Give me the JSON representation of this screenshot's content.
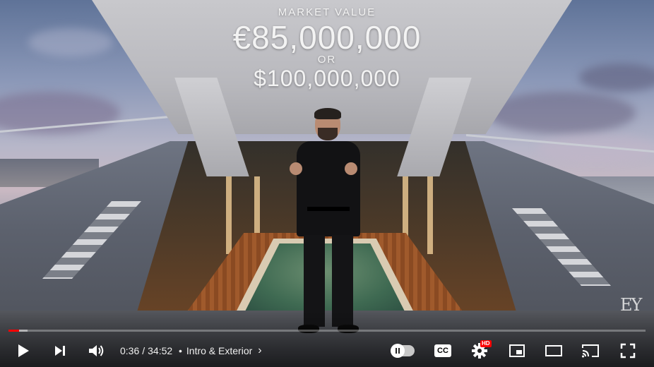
{
  "overlay": {
    "label": "MARKET VALUE",
    "eur": "€85,000,000",
    "or": "OR",
    "usd": "$100,000,000"
  },
  "brand": {
    "watermark": "EY"
  },
  "player": {
    "current_time": "0:36",
    "separator": "/",
    "duration": "34:52",
    "chapter_bullet": "•",
    "chapter": "Intro & Exterior",
    "progress_played_fraction": 0.017,
    "progress_loaded_fraction": 0.03,
    "hd_badge": "HD",
    "cc_label": "CC",
    "colors": {
      "progress_played": "#ff0000",
      "hd_badge": "#ff0000"
    }
  },
  "icons": {
    "play": "play-icon",
    "next": "next-icon",
    "volume": "volume-icon",
    "chapter_chevron": "chevron-right-icon",
    "autoplay": "autoplay-toggle-icon",
    "captions": "captions-icon",
    "settings": "gear-icon",
    "miniplayer": "miniplayer-icon",
    "theater": "theater-mode-icon",
    "cast": "cast-icon",
    "fullscreen": "fullscreen-icon"
  }
}
